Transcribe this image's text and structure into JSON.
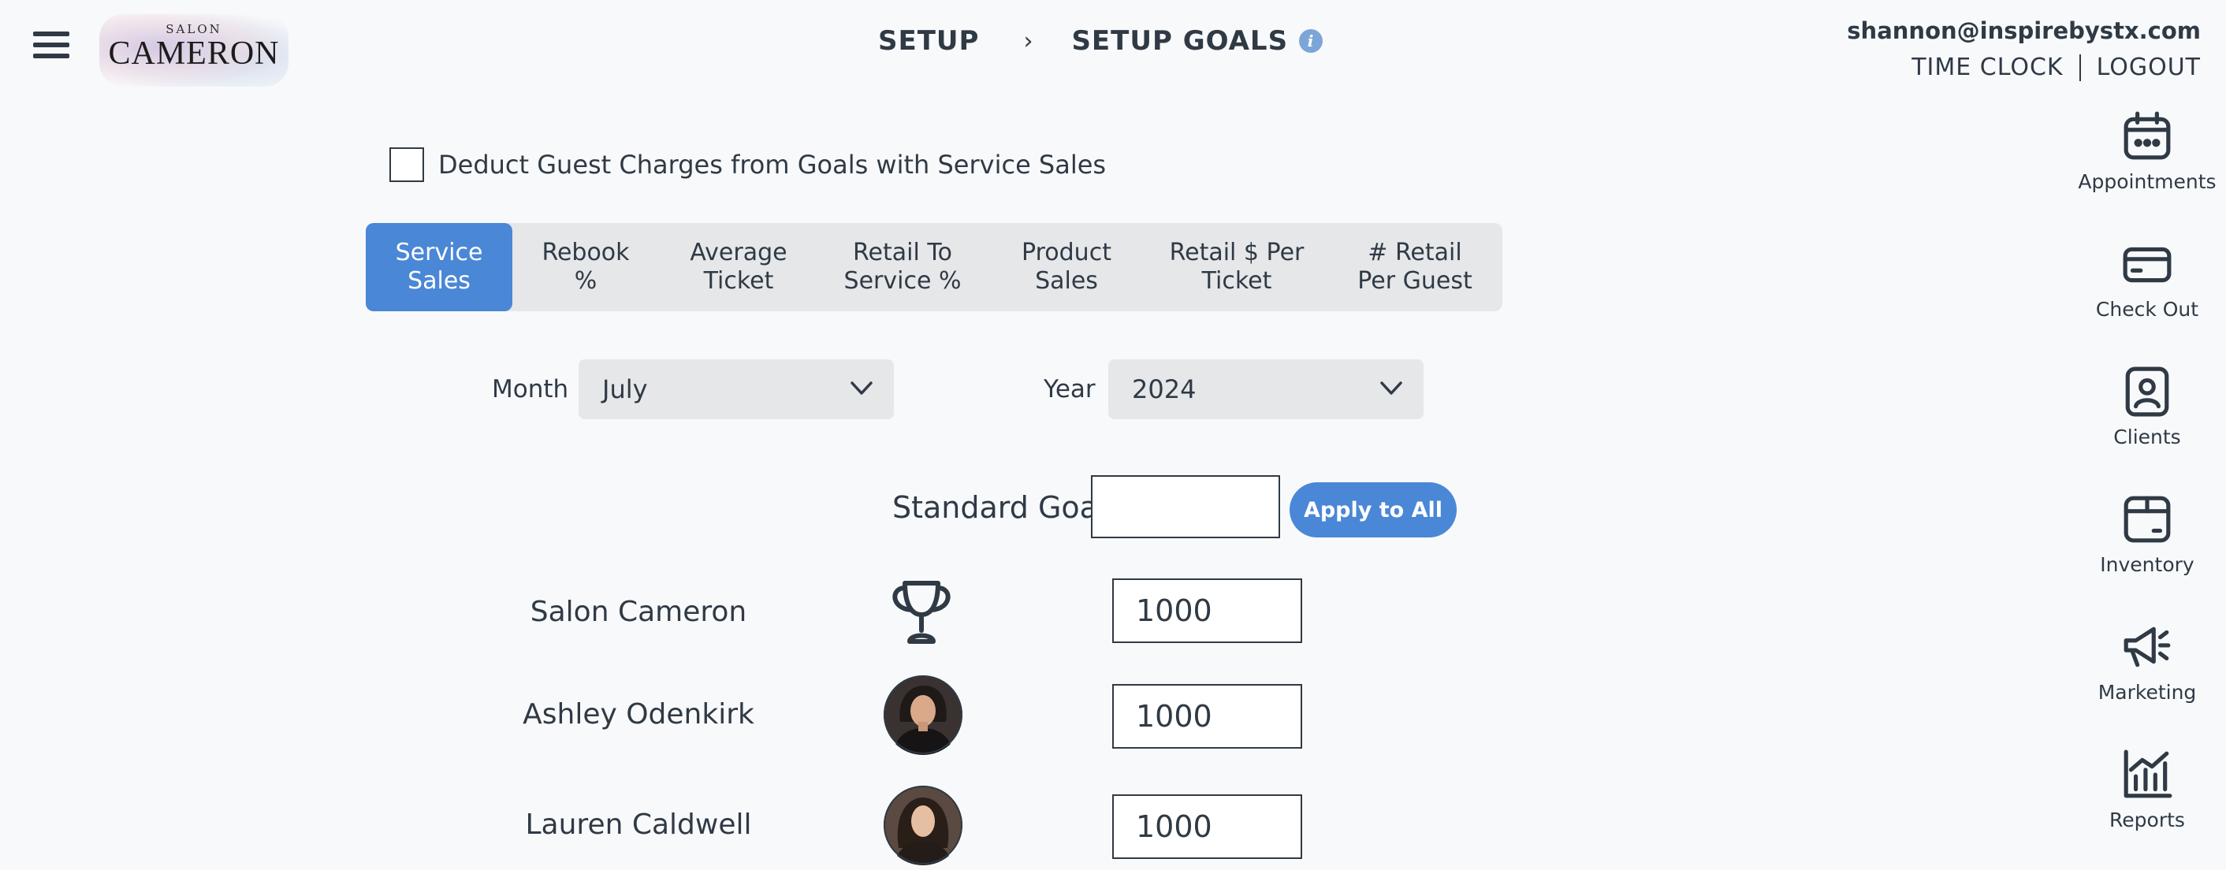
{
  "brand": {
    "small": "SALON",
    "big": "CAMERON"
  },
  "breadcrumb": {
    "parent": "SETUP",
    "separator": "›",
    "current": "SETUP GOALS",
    "info_glyph": "i"
  },
  "account": {
    "email": "shannon@inspirebystx.com",
    "time_clock": "TIME CLOCK",
    "logout": "LOGOUT"
  },
  "side_nav": [
    {
      "label": "Appointments",
      "icon": "calendar-icon"
    },
    {
      "label": "Check Out",
      "icon": "credit-card-icon"
    },
    {
      "label": "Clients",
      "icon": "client-contact-icon"
    },
    {
      "label": "Inventory",
      "icon": "box-icon"
    },
    {
      "label": "Marketing",
      "icon": "megaphone-icon"
    },
    {
      "label": "Reports",
      "icon": "bar-chart-icon"
    }
  ],
  "deduct_option": {
    "label": "Deduct Guest Charges from Goals with Service Sales",
    "checked": false
  },
  "tabs": [
    {
      "line1": "Service",
      "line2": "Sales",
      "active": true
    },
    {
      "line1": "Rebook",
      "line2": "%",
      "active": false
    },
    {
      "line1": "Average",
      "line2": "Ticket",
      "active": false
    },
    {
      "line1": "Retail To",
      "line2": "Service %",
      "active": false
    },
    {
      "line1": "Product",
      "line2": "Sales",
      "active": false
    },
    {
      "line1": "Retail $ Per",
      "line2": "Ticket",
      "active": false
    },
    {
      "line1": "# Retail",
      "line2": "Per Guest",
      "active": false
    }
  ],
  "filters": {
    "month_label": "Month",
    "month_value": "July",
    "year_label": "Year",
    "year_value": "2024"
  },
  "standard_goal": {
    "label": "Standard Goal",
    "value": "",
    "apply_label": "Apply to All"
  },
  "goals": [
    {
      "name": "Salon Cameron",
      "avatar": "trophy-icon",
      "value": "1000"
    },
    {
      "name": "Ashley Odenkirk",
      "avatar": "photo",
      "value": "1000"
    },
    {
      "name": "Lauren Caldwell",
      "avatar": "photo",
      "value": "1000"
    }
  ],
  "colors": {
    "accent": "#4a87d6",
    "text": "#2f3a45",
    "tab_bg": "#e6e7e9",
    "info": "#7da6d8"
  }
}
